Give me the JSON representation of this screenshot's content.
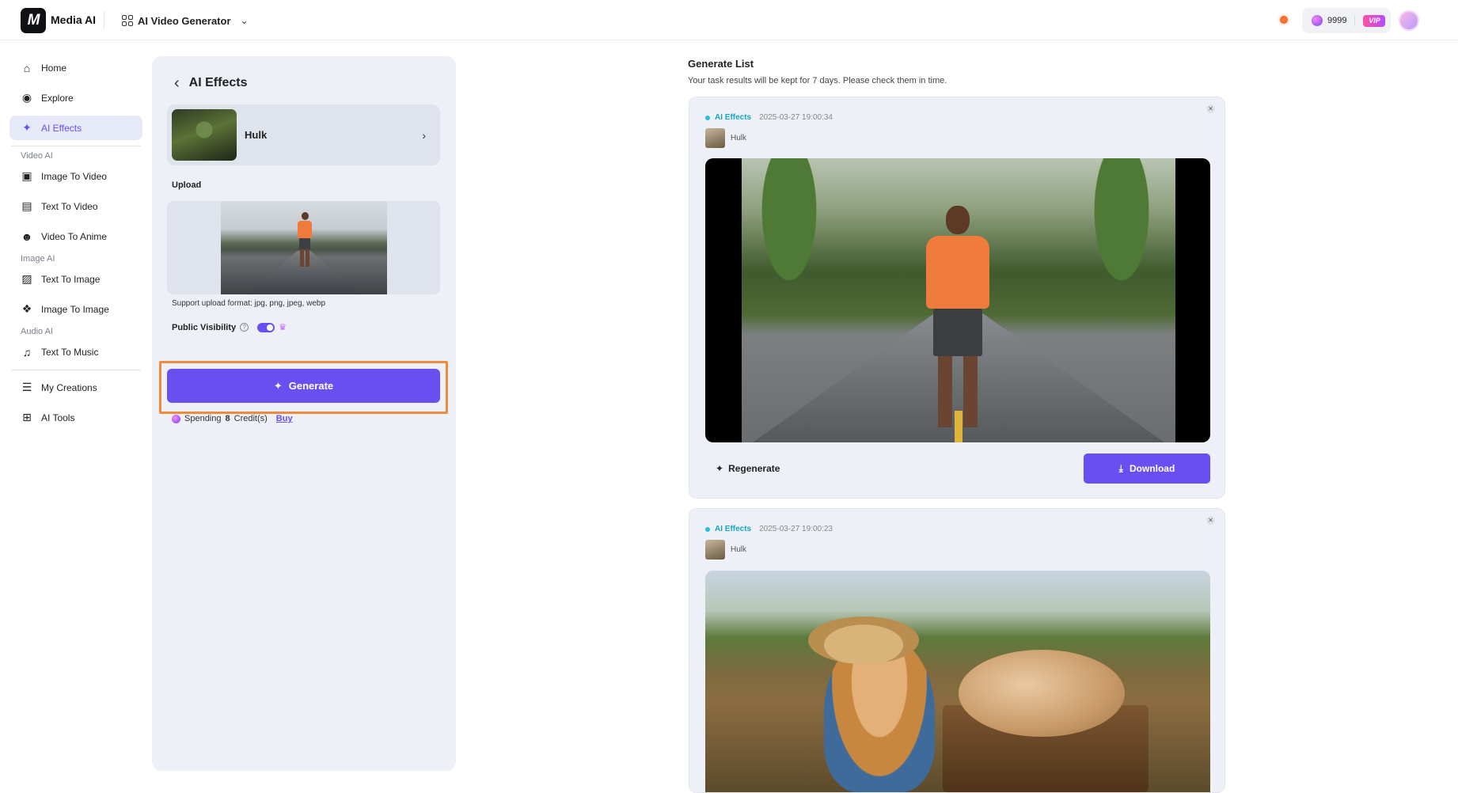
{
  "topbar": {
    "logo_text": "M",
    "brand": "Media AI",
    "app_switch_label": "AI Video Generator",
    "credits": "9999",
    "vip_label": "VIP"
  },
  "sidebar": {
    "items_top": [
      {
        "label": "Home",
        "icon": "home-icon"
      },
      {
        "label": "Explore",
        "icon": "compass-icon"
      },
      {
        "label": "AI Effects",
        "icon": "sparkles-icon",
        "active": true
      }
    ],
    "group_video": "Video AI",
    "items_video": [
      {
        "label": "Image To Video",
        "icon": "image-video-icon"
      },
      {
        "label": "Text To Video",
        "icon": "text-video-icon"
      },
      {
        "label": "Video To Anime",
        "icon": "anime-icon"
      }
    ],
    "group_image": "Image AI",
    "items_image": [
      {
        "label": "Text To Image",
        "icon": "text-image-icon"
      },
      {
        "label": "Image To Image",
        "icon": "image-image-icon"
      }
    ],
    "group_audio": "Audio AI",
    "items_audio": [
      {
        "label": "Text To Music",
        "icon": "music-note-icon"
      }
    ],
    "items_bottom": [
      {
        "label": "My Creations",
        "icon": "stack-icon"
      },
      {
        "label": "AI Tools",
        "icon": "tools-grid-icon"
      }
    ]
  },
  "panel": {
    "title": "AI Effects",
    "effect_name": "Hulk",
    "upload_label": "Upload",
    "upload_hint": "Support upload format: jpg, png, jpeg, webp",
    "visibility_label": "Public Visibility",
    "visibility_on": true,
    "generate_label": "Generate",
    "spend_prefix": "Spending",
    "spend_amount": "8",
    "spend_suffix": "Credit(s)",
    "buy_label": "Buy"
  },
  "list": {
    "title": "Generate List",
    "subtitle": "Your task results will be kept for 7 days. Please check them in time.",
    "tasks": [
      {
        "tag": "AI Effects",
        "time": "2025-03-27 19:00:34",
        "effect": "Hulk",
        "regenerate_label": "Regenerate",
        "download_label": "Download"
      },
      {
        "tag": "AI Effects",
        "time": "2025-03-27 19:00:23",
        "effect": "Hulk"
      }
    ]
  },
  "colors": {
    "accent": "#6a4ff0",
    "highlight": "#f08a3e",
    "tag": "#18a6bf"
  }
}
